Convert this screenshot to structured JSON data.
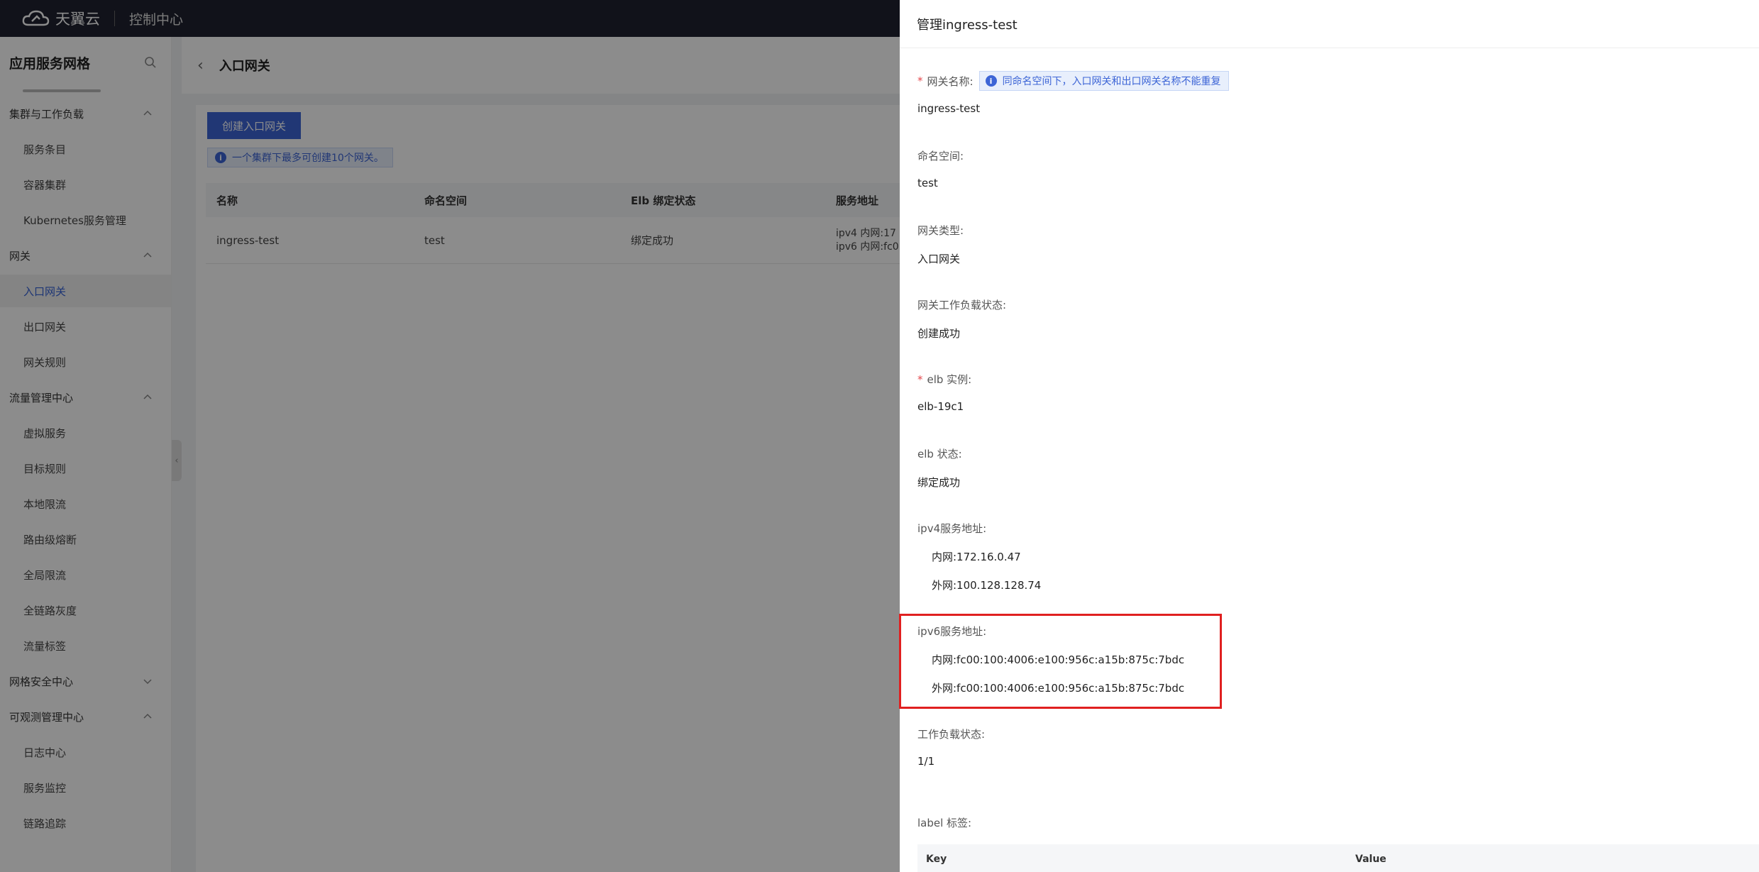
{
  "topbar": {
    "brand": "天翼云",
    "console": "控制中心"
  },
  "sidebar": {
    "title": "应用服务网格",
    "menu": [
      {
        "label": "集群与工作负载",
        "type": "group",
        "expanded": true
      },
      {
        "label": "服务条目",
        "type": "item"
      },
      {
        "label": "容器集群",
        "type": "item"
      },
      {
        "label": "Kubernetes服务管理",
        "type": "item"
      },
      {
        "label": "网关",
        "type": "group",
        "expanded": true
      },
      {
        "label": "入口网关",
        "type": "item",
        "active": true
      },
      {
        "label": "出口网关",
        "type": "item"
      },
      {
        "label": "网关规则",
        "type": "item"
      },
      {
        "label": "流量管理中心",
        "type": "group",
        "expanded": true
      },
      {
        "label": "虚拟服务",
        "type": "item"
      },
      {
        "label": "目标规则",
        "type": "item"
      },
      {
        "label": "本地限流",
        "type": "item"
      },
      {
        "label": "路由级熔断",
        "type": "item"
      },
      {
        "label": "全局限流",
        "type": "item"
      },
      {
        "label": "全链路灰度",
        "type": "item"
      },
      {
        "label": "流量标签",
        "type": "item"
      },
      {
        "label": "网格安全中心",
        "type": "group",
        "expanded": false
      },
      {
        "label": "可观测管理中心",
        "type": "group",
        "expanded": true
      },
      {
        "label": "日志中心",
        "type": "item"
      },
      {
        "label": "服务监控",
        "type": "item"
      },
      {
        "label": "链路追踪",
        "type": "item"
      }
    ]
  },
  "main": {
    "page_title": "入口网关",
    "create_button": "创建入口网关",
    "notice": "一个集群下最多可创建10个网关。",
    "table": {
      "headers": [
        "名称",
        "命名空间",
        "Elb 绑定状态",
        "服务地址"
      ],
      "rows": [
        {
          "name": "ingress-test",
          "namespace": "test",
          "elb_status": "绑定成功",
          "addr_v4": "ipv4  内网:17",
          "addr_v6": "ipv6  内网:fc0"
        }
      ]
    }
  },
  "drawer": {
    "title": "管理ingress-test",
    "fields": {
      "gateway_name_label": "网关名称:",
      "gateway_name_tip": "同命名空间下，入口网关和出口网关名称不能重复",
      "gateway_name_value": "ingress-test",
      "namespace_label": "命名空间:",
      "namespace_value": "test",
      "gateway_type_label": "网关类型:",
      "gateway_type_value": "入口网关",
      "workload_status_label": "网关工作负载状态:",
      "workload_status_value": "创建成功",
      "elb_instance_label": "elb 实例:",
      "elb_instance_value": "elb-19c1",
      "elb_status_label": "elb 状态:",
      "elb_status_value": "绑定成功",
      "ipv4_label": "ipv4服务地址:",
      "ipv4_internal": "内网:172.16.0.47",
      "ipv4_external": "外网:100.128.128.74",
      "ipv6_label": "ipv6服务地址:",
      "ipv6_internal": "内网:fc00:100:4006:e100:956c:a15b:875c:7bdc",
      "ipv6_external": "外网:fc00:100:4006:e100:956c:a15b:875c:7bdc",
      "workload_label": "工作负载状态:",
      "workload_value": "1/1",
      "label_tags_label": "label 标签:"
    },
    "label_table_headers": {
      "key": "Key",
      "value": "Value"
    }
  },
  "colors": {
    "primary": "#3d65d6",
    "topbar": "#1f2230",
    "highlight": "#e02020",
    "required": "#e5484d"
  }
}
